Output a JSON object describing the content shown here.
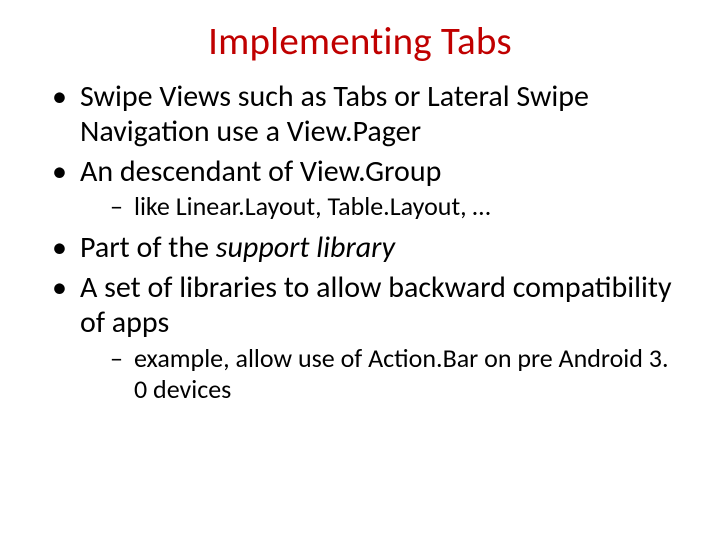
{
  "title": "Implementing Tabs",
  "bullets": {
    "b1": "Swipe Views such as Tabs or Lateral Swipe Navigation use a View.Pager",
    "b2": "An descendant of View.Group",
    "b2_sub1": "like Linear.Layout, Table.Layout, …",
    "b3_pre": "Part of the ",
    "b3_em": "support library",
    "b4": "A set of libraries to allow backward compatibility of apps",
    "b4_sub1": "example, allow use of Action.Bar on pre Android 3. 0 devices"
  }
}
